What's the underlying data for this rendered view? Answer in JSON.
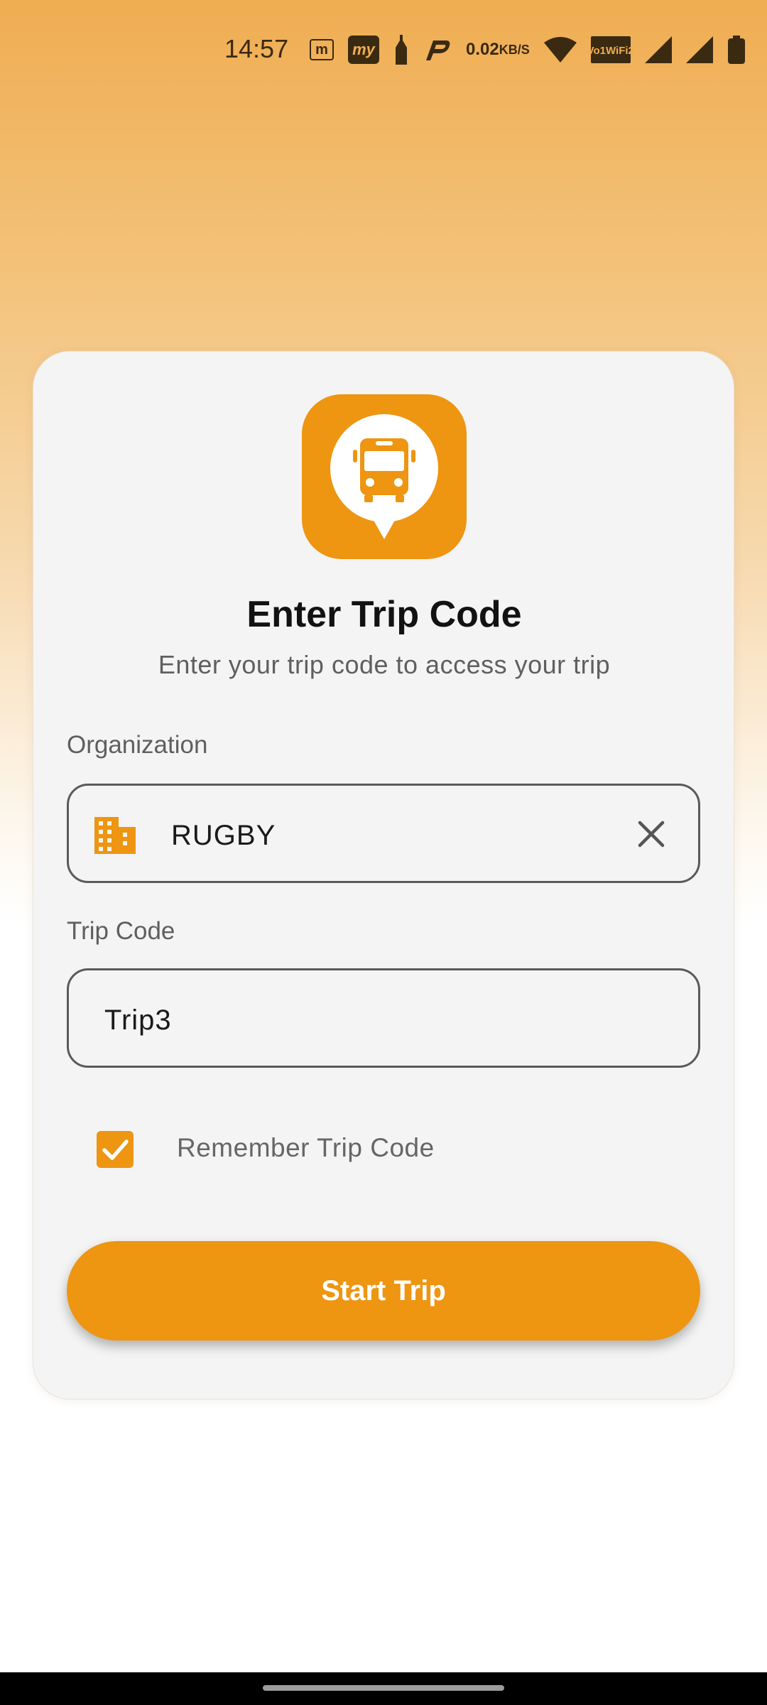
{
  "status_bar": {
    "time": "14:57",
    "notification_icons": [
      "moneycontrol-icon",
      "my-app-icon",
      "bottle-icon",
      "paytm-icon"
    ],
    "speed_value": "0.02",
    "speed_unit": "KB/S",
    "volte_line1": "Vo",
    "volte_line2": "WiFi",
    "volte_badge_1": "1",
    "volte_badge_2": "2",
    "m_label": "m",
    "my_label": "my"
  },
  "card": {
    "title": "Enter Trip Code",
    "subtitle": "Enter your trip code to access your trip"
  },
  "organization": {
    "label": "Organization",
    "value": "RUGBY",
    "icon": "building-icon"
  },
  "trip_code": {
    "label": "Trip Code",
    "value": "Trip3"
  },
  "remember": {
    "label": "Remember Trip Code",
    "checked": true
  },
  "start_button": {
    "label": "Start Trip"
  },
  "colors": {
    "accent": "#ee9511",
    "gradient_top": "#f0ad52",
    "card_bg": "#f4f4f4"
  }
}
